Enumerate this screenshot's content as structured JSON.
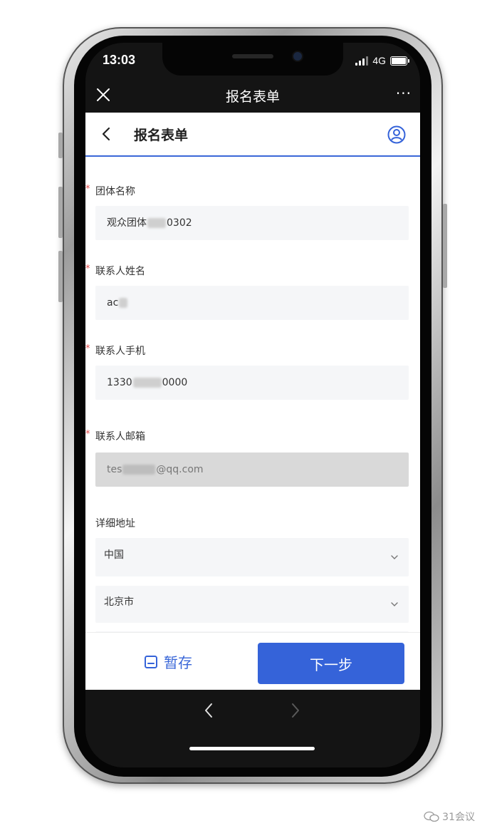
{
  "status_bar": {
    "time": "13:03",
    "network": "4G"
  },
  "wechat_bar": {
    "title": "报名表单",
    "more": "···"
  },
  "nav": {
    "title": "报名表单"
  },
  "fields": [
    {
      "label": "团体名称",
      "required": "*",
      "value_prefix": "观众团体",
      "value_suffix": "0302"
    },
    {
      "label": "联系人姓名",
      "required": "*",
      "value_prefix": "ac",
      "value_suffix": ""
    },
    {
      "label": "联系人手机",
      "required": "*",
      "value_prefix": "1330",
      "value_suffix": "0000"
    },
    {
      "label": "联系人邮箱",
      "required": "*",
      "value_prefix": "tes",
      "value_suffix": "@qq.com"
    }
  ],
  "address": {
    "label": "详细地址",
    "country": "中国",
    "city": "北京市"
  },
  "actions": {
    "save_label": "暂存",
    "next_label": "下一步"
  },
  "watermark": {
    "text": "31会议"
  },
  "colors": {
    "accent": "#3563d9",
    "required": "#e34b4b"
  }
}
